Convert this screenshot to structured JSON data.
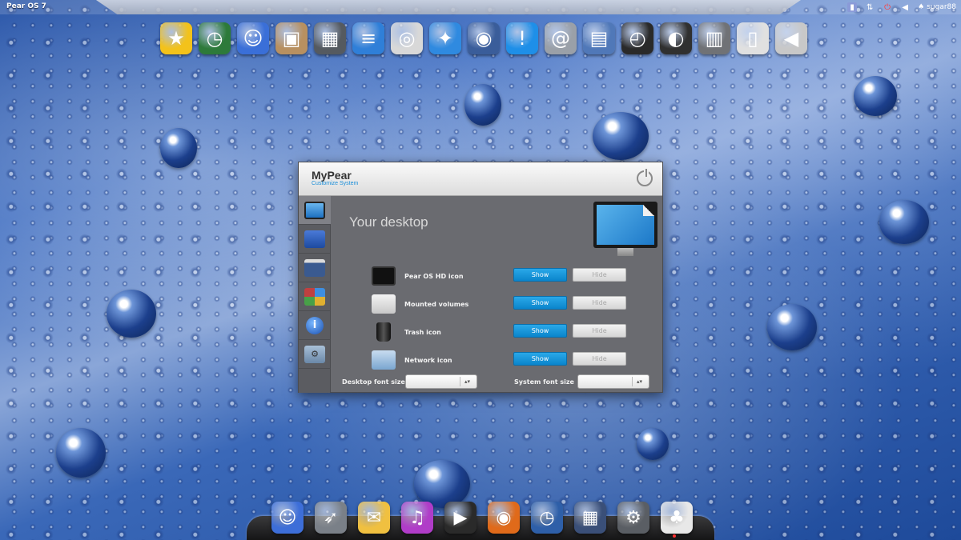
{
  "top_panel": {
    "os_name": "Pear OS 7",
    "username": "sugar88",
    "tray_icons": [
      "keyboard-layout-icon",
      "network-arrows-icon",
      "power-indicator-icon",
      "volume-icon",
      "pear-user-icon"
    ]
  },
  "top_dock": {
    "items": [
      {
        "name": "favorites-star-icon",
        "glyph": "★",
        "color": "#f3c21b"
      },
      {
        "name": "time-machine-icon",
        "glyph": "◷",
        "color": "#2d7a3a"
      },
      {
        "name": "finder-icon",
        "glyph": "☺",
        "color": "#3a6fd8"
      },
      {
        "name": "installer-package-icon",
        "glyph": "▣",
        "color": "#b89060"
      },
      {
        "name": "calculator-icon",
        "glyph": "▦",
        "color": "#555a60"
      },
      {
        "name": "documents-icon",
        "glyph": "≡",
        "color": "#2f7fd8"
      },
      {
        "name": "dvd-player-icon",
        "glyph": "◎",
        "color": "#d8d8d8"
      },
      {
        "name": "safari-compass-icon",
        "glyph": "✦",
        "color": "#2f8ae0"
      },
      {
        "name": "screen-capture-icon",
        "glyph": "◉",
        "color": "#3a5d9a"
      },
      {
        "name": "messages-icon",
        "glyph": "!",
        "color": "#1e8fe8"
      },
      {
        "name": "mail-at-icon",
        "glyph": "@",
        "color": "#9aa0a8"
      },
      {
        "name": "mission-control-icon",
        "glyph": "▤",
        "color": "#5078b8"
      },
      {
        "name": "clock-icon",
        "glyph": "◴",
        "color": "#2a2a2a"
      },
      {
        "name": "gauges-icon",
        "glyph": "◐",
        "color": "#303030"
      },
      {
        "name": "trash-icon",
        "glyph": "▥",
        "color": "#707276"
      },
      {
        "name": "switch-icon",
        "glyph": "▯",
        "color": "#e0e0e0"
      },
      {
        "name": "speaker-icon",
        "glyph": "◀",
        "color": "#c8c8c8"
      }
    ]
  },
  "window": {
    "app_title": "MyPear",
    "app_subtitle": "Customize System",
    "section_title": "Your desktop",
    "rows": [
      {
        "label": "Pear OS HD icon",
        "show": "Show",
        "hide": "Hide"
      },
      {
        "label": "Mounted volumes",
        "show": "Show",
        "hide": "Hide"
      },
      {
        "label": "Trash icon",
        "show": "Show",
        "hide": "Hide"
      },
      {
        "label": "Network icon",
        "show": "Show",
        "hide": "Hide"
      }
    ],
    "desktop_font_label": "Desktop font size",
    "desktop_font_value": "",
    "system_font_label": "System font size",
    "system_font_value": "",
    "spinner_glyph": "▴▾"
  },
  "bottom_dock": {
    "items": [
      {
        "name": "finder-icon",
        "glyph": "☺",
        "color": "#3d6ed8"
      },
      {
        "name": "launchpad-rocket-icon",
        "glyph": "➶",
        "color": "#7a8088"
      },
      {
        "name": "mail-envelope-icon",
        "glyph": "✉",
        "color": "#f0c040"
      },
      {
        "name": "itunes-music-icon",
        "glyph": "♫",
        "color": "#b03cc8"
      },
      {
        "name": "video-player-icon",
        "glyph": "▶",
        "color": "#2a2a2a"
      },
      {
        "name": "firefox-icon",
        "glyph": "◉",
        "color": "#e06a1a"
      },
      {
        "name": "time-machine-icon",
        "glyph": "◷",
        "color": "#2e5fa8"
      },
      {
        "name": "app-store-icon",
        "glyph": "▦",
        "color": "#3a4f78"
      },
      {
        "name": "system-preferences-icon",
        "glyph": "⚙",
        "color": "#5a5e64"
      },
      {
        "name": "pear-about-icon",
        "glyph": "♣",
        "color": "#e8e8e8"
      }
    ]
  }
}
